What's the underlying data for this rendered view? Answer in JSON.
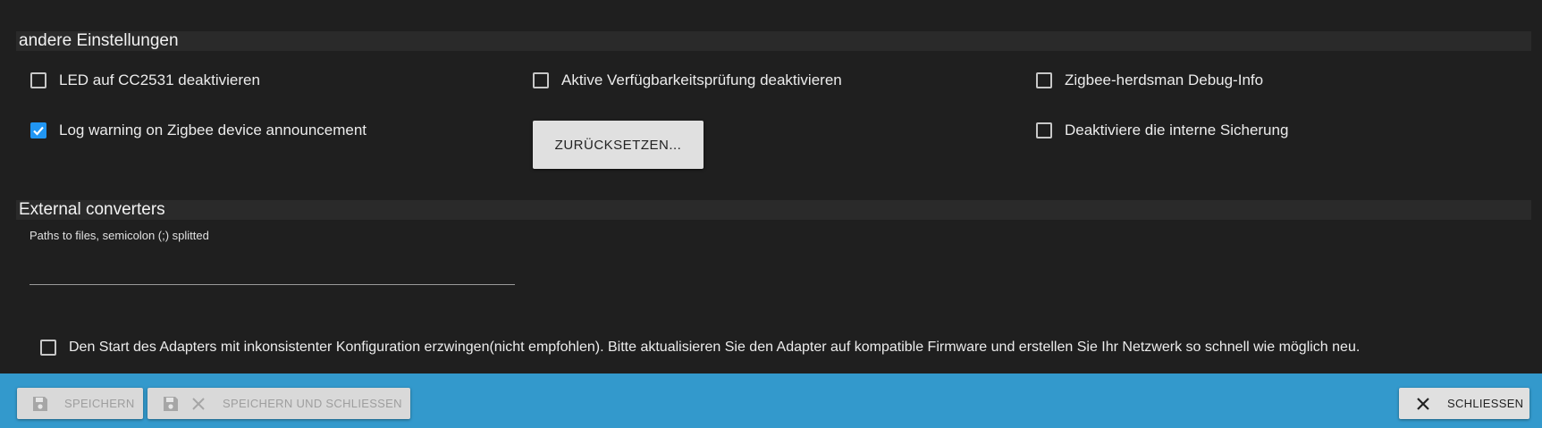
{
  "sections": {
    "other_settings_title": "andere Einstellungen",
    "external_title": "External converters"
  },
  "checkboxes": {
    "led": {
      "label": "LED auf CC2531 deaktivieren",
      "checked": false
    },
    "log_warning": {
      "label": "Log warning on Zigbee device announcement",
      "checked": true
    },
    "availability": {
      "label": "Aktive Verfügbarkeitsprüfung deaktivieren",
      "checked": false
    },
    "debug": {
      "label": "Zigbee-herdsman Debug-Info",
      "checked": false
    },
    "backup": {
      "label": "Deaktiviere die interne Sicherung",
      "checked": false
    },
    "force_start": {
      "label": "Den Start des Adapters mit inkonsistenter Konfiguration erzwingen(nicht empfohlen). Bitte aktualisieren Sie den Adapter auf kompatible Firmware und erstellen Sie Ihr Netzwerk so schnell wie möglich neu.",
      "checked": false
    }
  },
  "reset_button": "ZURÜCKSETZEN...",
  "external": {
    "field_label": "Paths to files, semicolon (;) splitted",
    "field_value": ""
  },
  "footer": {
    "save": "SPEICHERN",
    "save_close": "SPEICHERN UND SCHLIESSEN",
    "close": "SCHLIESSEN"
  },
  "colors": {
    "background": "#1f1f1f",
    "section_bar": "#2a2a2a",
    "accent": "#2196f3",
    "footer": "#3399cc"
  },
  "icons": [
    "check-icon",
    "floppy-disk-icon",
    "close-icon"
  ]
}
